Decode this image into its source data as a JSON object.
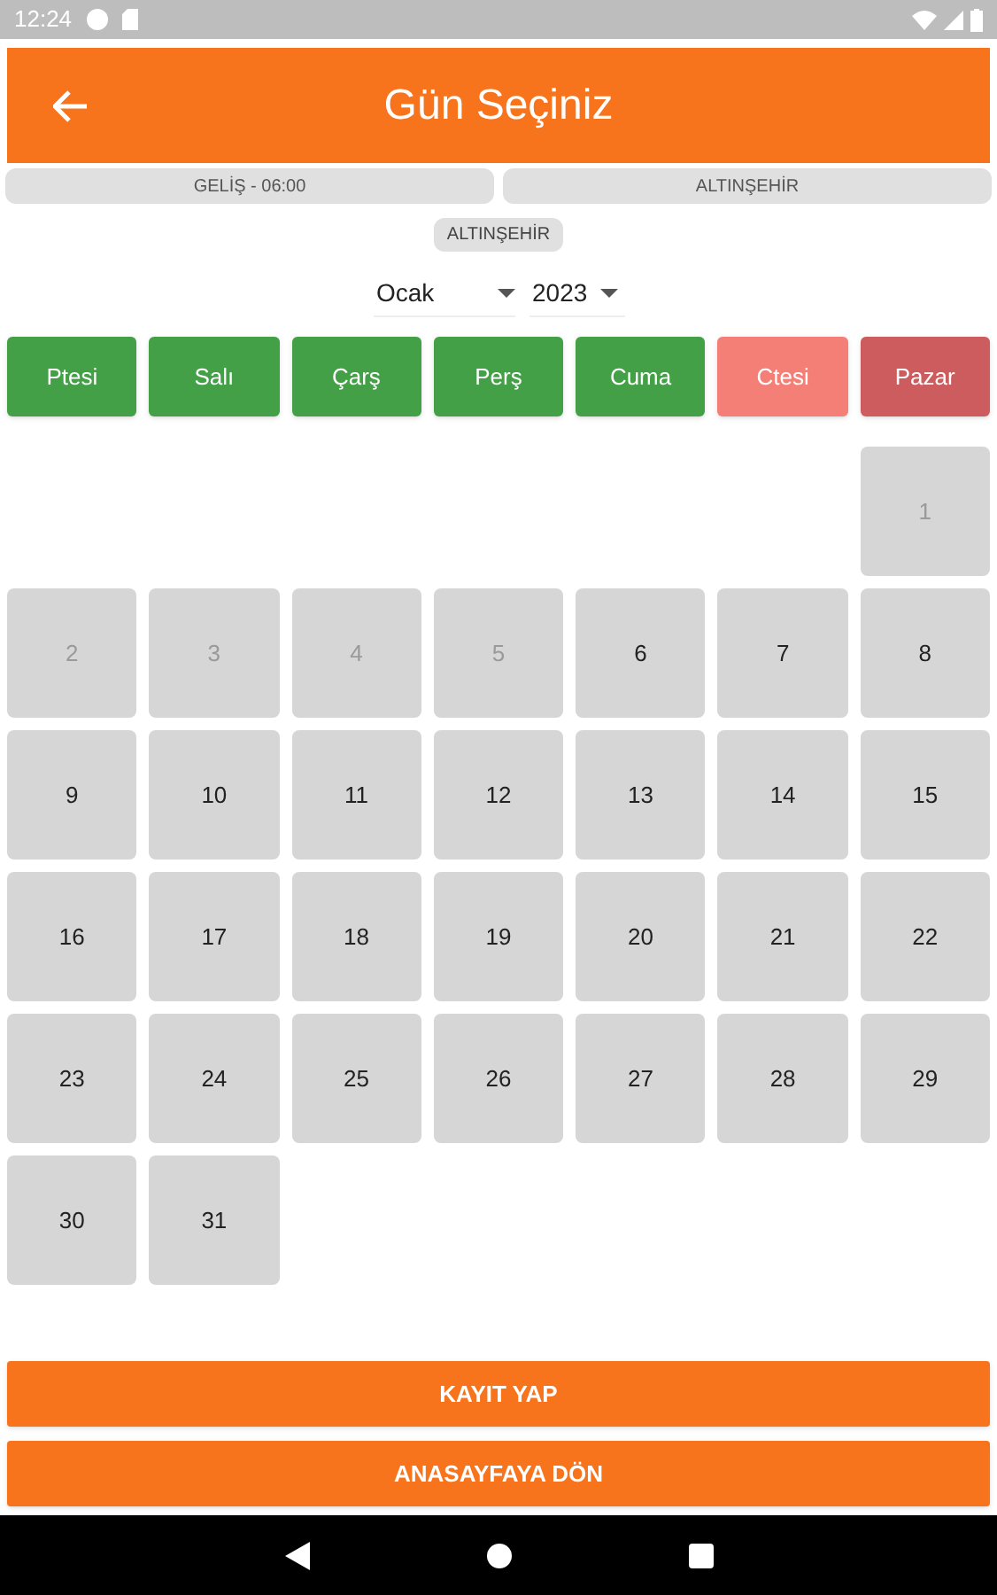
{
  "status_bar": {
    "time": "12:24"
  },
  "app_bar": {
    "title": "Gün Seçiniz"
  },
  "info_chips": [
    "GELİŞ - 06:00",
    "ALTINŞEHİR"
  ],
  "location_chip": "ALTINŞEHİR",
  "month_select": {
    "value": "Ocak"
  },
  "year_select": {
    "value": "2023"
  },
  "weekdays": [
    {
      "label": "Ptesi",
      "color": "#43a047"
    },
    {
      "label": "Salı",
      "color": "#43a047"
    },
    {
      "label": "Çarş",
      "color": "#43a047"
    },
    {
      "label": "Perş",
      "color": "#43a047"
    },
    {
      "label": "Cuma",
      "color": "#43a047"
    },
    {
      "label": "Ctesi",
      "color": "#f47f77"
    },
    {
      "label": "Pazar",
      "color": "#cd5c5e"
    }
  ],
  "days": [
    {
      "label": "1",
      "disabled": true
    },
    {
      "label": "2",
      "disabled": true
    },
    {
      "label": "3",
      "disabled": true
    },
    {
      "label": "4",
      "disabled": true
    },
    {
      "label": "5",
      "disabled": true
    },
    {
      "label": "6",
      "disabled": false
    },
    {
      "label": "7",
      "disabled": false
    },
    {
      "label": "8",
      "disabled": false
    },
    {
      "label": "9",
      "disabled": false
    },
    {
      "label": "10",
      "disabled": false
    },
    {
      "label": "11",
      "disabled": false
    },
    {
      "label": "12",
      "disabled": false
    },
    {
      "label": "13",
      "disabled": false
    },
    {
      "label": "14",
      "disabled": false
    },
    {
      "label": "15",
      "disabled": false
    },
    {
      "label": "16",
      "disabled": false
    },
    {
      "label": "17",
      "disabled": false
    },
    {
      "label": "18",
      "disabled": false
    },
    {
      "label": "19",
      "disabled": false
    },
    {
      "label": "20",
      "disabled": false
    },
    {
      "label": "21",
      "disabled": false
    },
    {
      "label": "22",
      "disabled": false
    },
    {
      "label": "23",
      "disabled": false
    },
    {
      "label": "24",
      "disabled": false
    },
    {
      "label": "25",
      "disabled": false
    },
    {
      "label": "26",
      "disabled": false
    },
    {
      "label": "27",
      "disabled": false
    },
    {
      "label": "28",
      "disabled": false
    },
    {
      "label": "29",
      "disabled": false
    },
    {
      "label": "30",
      "disabled": false
    },
    {
      "label": "31",
      "disabled": false
    }
  ],
  "buttons": [
    "KAYIT YAP",
    "ANASAYFAYA DÖN"
  ]
}
